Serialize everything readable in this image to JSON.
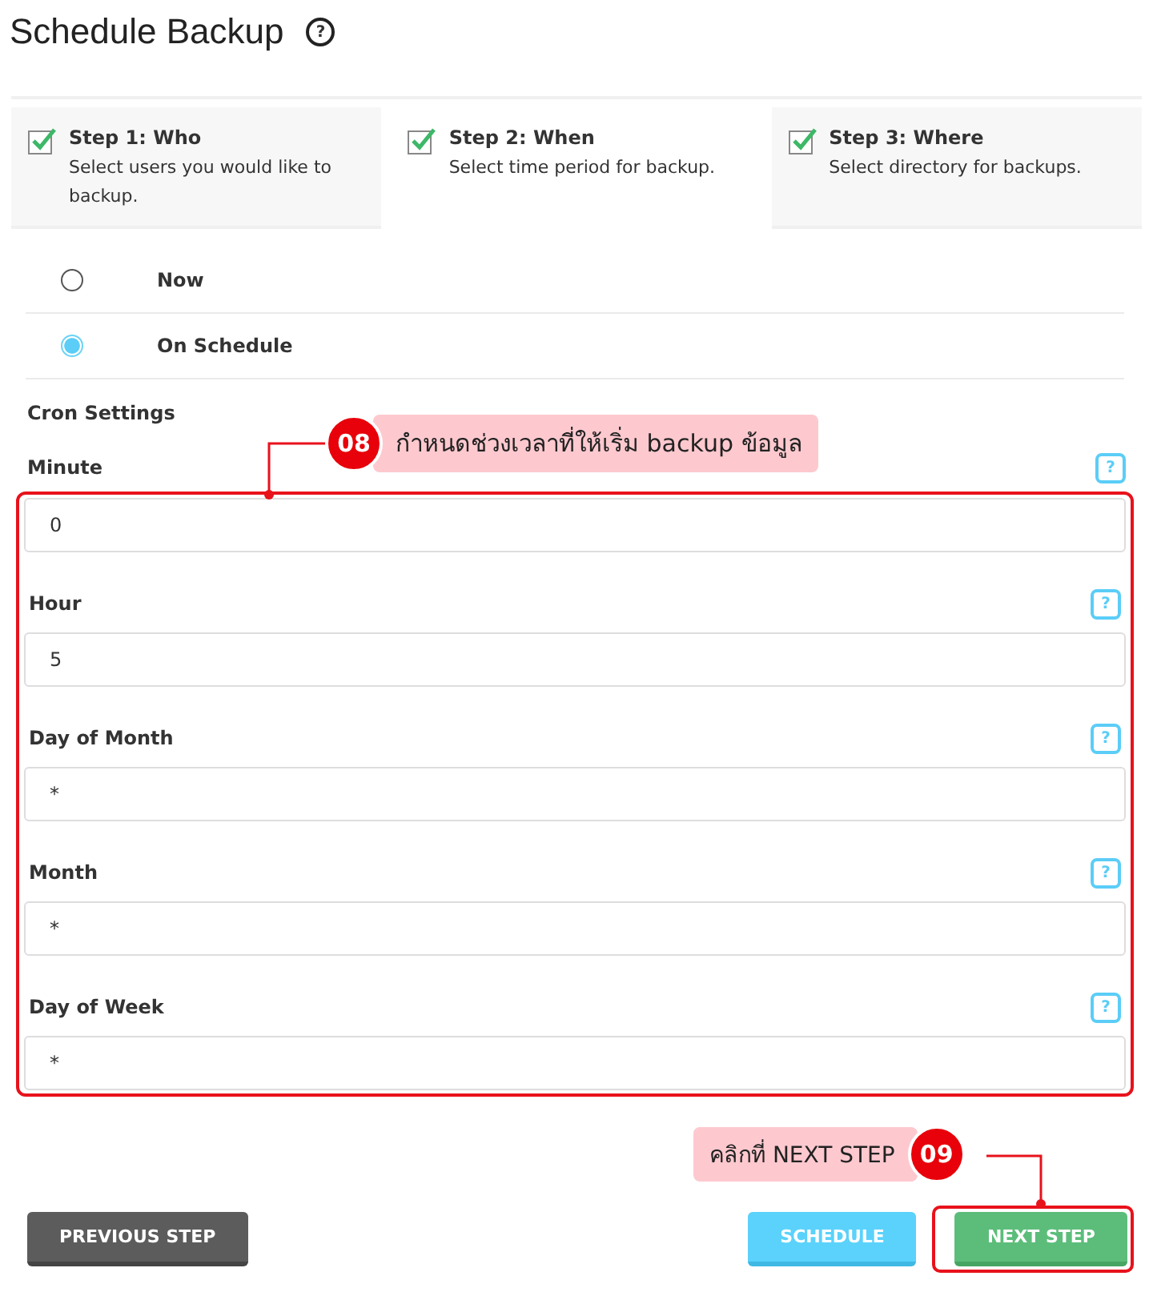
{
  "page": {
    "title": "Schedule Backup",
    "help": "?"
  },
  "steps": [
    {
      "title": "Step 1: Who",
      "description": "Select users you would like to backup.",
      "checked": true,
      "selected": false
    },
    {
      "title": "Step 2: When",
      "description": "Select time period for backup.",
      "checked": true,
      "selected": true
    },
    {
      "title": "Step 3: Where",
      "description": "Select directory for backups.",
      "checked": true,
      "selected": false
    }
  ],
  "timing": [
    {
      "label": "Now",
      "selected": false
    },
    {
      "label": "On Schedule",
      "selected": true
    }
  ],
  "cron": {
    "heading": "Cron Settings",
    "fields": [
      {
        "label": "Minute",
        "value": "0",
        "help": "?"
      },
      {
        "label": "Hour",
        "value": "5",
        "help": "?"
      },
      {
        "label": "Day of Month",
        "value": "*",
        "help": "?"
      },
      {
        "label": "Month",
        "value": "*",
        "help": "?"
      },
      {
        "label": "Day of Week",
        "value": "*",
        "help": "?"
      }
    ]
  },
  "buttons": [
    {
      "label": "PREVIOUS STEP",
      "kind": "previous"
    },
    {
      "label": "SCHEDULE",
      "kind": "schedule"
    },
    {
      "label": "NEXT STEP",
      "kind": "next"
    }
  ],
  "annotations": [
    {
      "number": "08",
      "text": "กำหนดช่วงเวลาที่ให้เริ่ม backup ข้อมูล"
    },
    {
      "number": "09",
      "text": "คลิกที่ NEXT STEP"
    }
  ]
}
